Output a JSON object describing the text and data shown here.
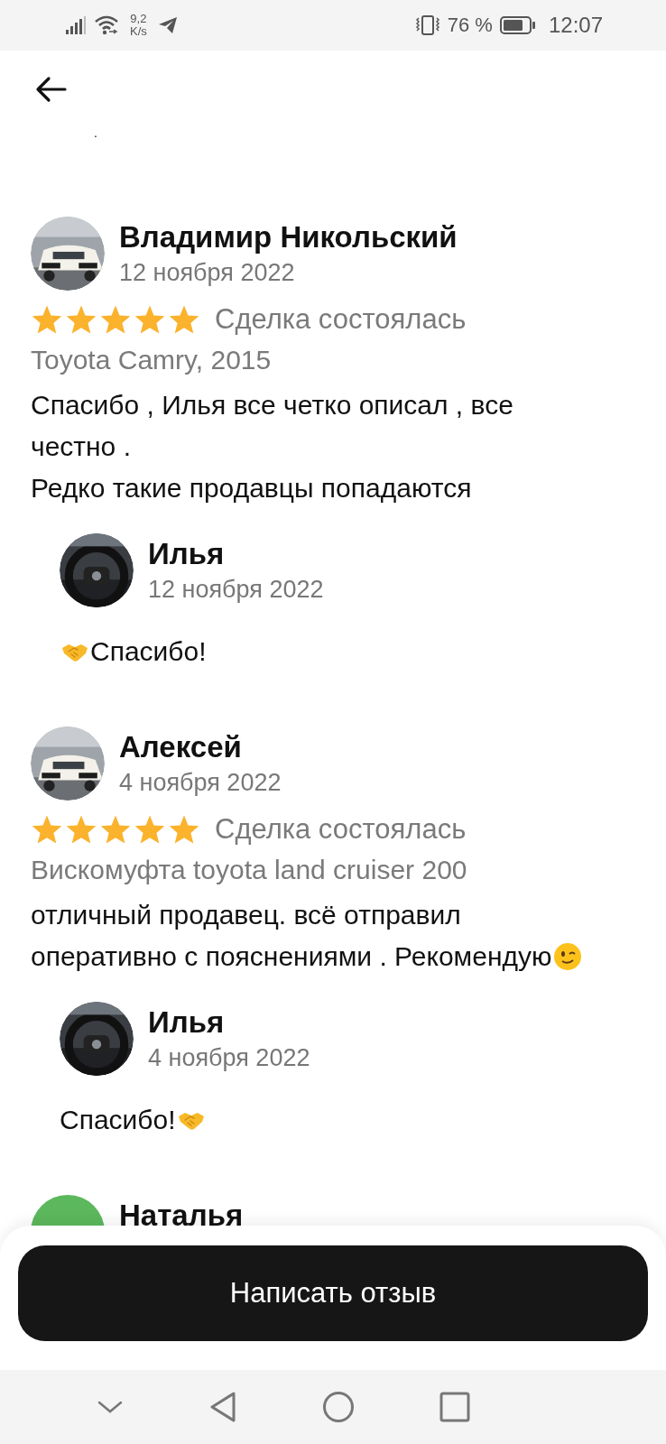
{
  "status_bar": {
    "speed_value": "9,2",
    "speed_unit": "K/s",
    "battery": "76 %",
    "time": "12:07"
  },
  "stray_mark": ".",
  "reviews": [
    {
      "author": "Владимир Никольский",
      "date": "12 ноября 2022",
      "stars": 5,
      "deal_status": "Сделка состоялась",
      "product": "Toyota Camry, 2015",
      "avatar": {
        "kind": "picture"
      },
      "text_lines": [
        "Спасибо , Илья все четко описал , все",
        "честно .",
        "Редко такие продавцы попадаются"
      ],
      "reply": {
        "author": "Илья",
        "date": "12 ноября 2022",
        "avatar": {
          "kind": "picture"
        },
        "parts": [
          {
            "kind": "handshake"
          },
          {
            "kind": "text",
            "text": "Спасибо!"
          }
        ]
      }
    },
    {
      "author": "Алексей",
      "date": "4 ноября 2022",
      "stars": 5,
      "deal_status": "Сделка состоялась",
      "product": "Вискомуфта toyota land cruiser 200",
      "avatar": {
        "kind": "picture"
      },
      "text_lines": [
        "отличный продавец. всё отправил",
        "оперативно с пояснениями . Рекомендую"
      ],
      "text_end_icons": [
        {
          "kind": "wink"
        }
      ],
      "reply": {
        "author": "Илья",
        "date": "4 ноября 2022",
        "avatar": {
          "kind": "picture"
        },
        "parts": [
          {
            "kind": "text",
            "text": "Спасибо!"
          },
          {
            "kind": "handshake"
          }
        ]
      }
    },
    {
      "author": "Наталья",
      "avatar": {
        "kind": "initial",
        "color": "#5cb85c"
      }
    }
  ],
  "write_button": "Написать отзыв"
}
